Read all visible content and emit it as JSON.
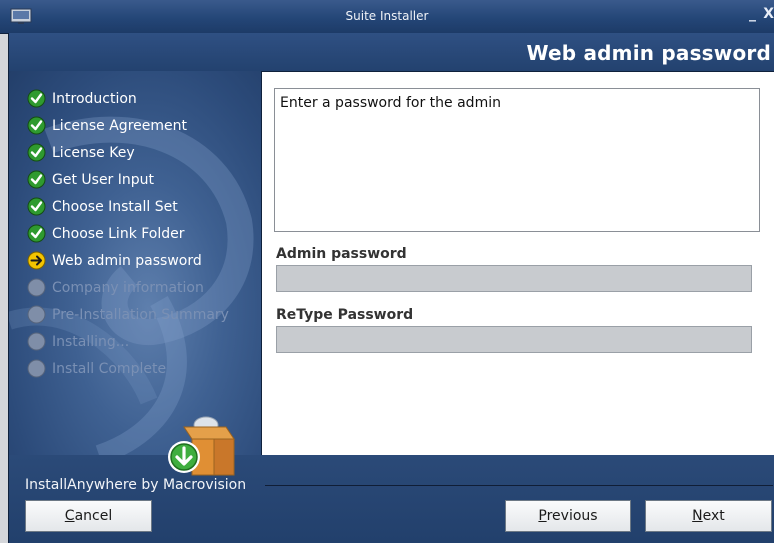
{
  "window": {
    "title": "Suite Installer",
    "minimize_glyph": "_",
    "close_glyph": "X"
  },
  "header": {
    "page_title": "Web admin password"
  },
  "steps": [
    {
      "label": "Introduction",
      "status": "done"
    },
    {
      "label": "License Agreement",
      "status": "done"
    },
    {
      "label": "License Key",
      "status": "done"
    },
    {
      "label": "Get User Input",
      "status": "done"
    },
    {
      "label": "Choose Install Set",
      "status": "done"
    },
    {
      "label": "Choose Link Folder",
      "status": "done"
    },
    {
      "label": "Web admin password",
      "status": "current"
    },
    {
      "label": "Company information",
      "status": "pending"
    },
    {
      "label": "Pre-Installation Summary",
      "status": "pending"
    },
    {
      "label": "Installing...",
      "status": "pending"
    },
    {
      "label": "Install Complete",
      "status": "pending"
    }
  ],
  "main": {
    "description": "Enter a password for the admin",
    "admin_password_label": "Admin password",
    "admin_password_value": "",
    "retype_password_label": "ReType Password",
    "retype_password_value": ""
  },
  "footer": {
    "vendor": "InstallAnywhere by Macrovision",
    "cancel": {
      "mnemonic": "C",
      "rest": "ancel"
    },
    "previous": {
      "mnemonic": "P",
      "rest": "revious"
    },
    "next": {
      "mnemonic": "N",
      "rest": "ext"
    }
  },
  "icons": {
    "done": "check-circle-icon",
    "current": "arrow-right-circle-icon",
    "pending": "gray-circle-icon"
  },
  "colors": {
    "done": "#3aa53a",
    "current": "#f3c400",
    "pending": "#7b8aa3",
    "accent": "#23426f"
  }
}
